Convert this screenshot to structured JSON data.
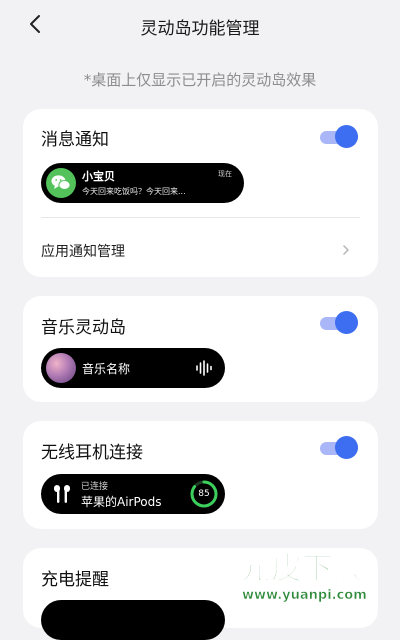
{
  "header": {
    "title": "灵动岛功能管理"
  },
  "hint": "*桌面上仅显示已开启的灵动岛效果",
  "colors": {
    "accent": "#3d6df0",
    "accent_track": "#a9b6f7",
    "wechat_green": "#53c25a",
    "battery_ring": "#3ccf5b"
  },
  "sections": {
    "message": {
      "title": "消息通知",
      "enabled": true,
      "preview": {
        "app_icon": "wechat-icon",
        "sender": "小宝贝",
        "time": "现在",
        "message": "今天回来吃饭吗？今天回来..."
      },
      "row_label": "应用通知管理"
    },
    "music": {
      "title": "音乐灵动岛",
      "enabled": true,
      "preview": {
        "track_name": "音乐名称"
      }
    },
    "earphone": {
      "title": "无线耳机连接",
      "enabled": true,
      "preview": {
        "status": "已连接",
        "device": "苹果的AirPods",
        "battery": "85",
        "battery_level": 0.85
      }
    },
    "charging": {
      "title": "充电提醒"
    }
  },
  "watermark": {
    "main": "元皮下载",
    "url": "www.yuanpi.com"
  }
}
